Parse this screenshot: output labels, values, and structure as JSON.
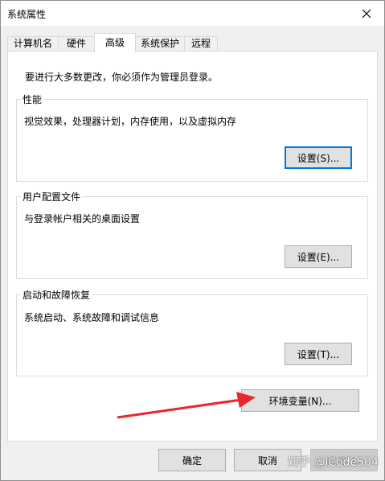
{
  "window": {
    "title": "系统属性"
  },
  "tabs": [
    {
      "label": "计算机名"
    },
    {
      "label": "硬件"
    },
    {
      "label": "高级"
    },
    {
      "label": "系统保护"
    },
    {
      "label": "远程"
    }
  ],
  "panel": {
    "intro": "要进行大多数更改，你必须作为管理员登录。",
    "performance": {
      "title": "性能",
      "desc": "视觉效果，处理器计划，内存使用，以及虚拟内存",
      "button": "设置(S)..."
    },
    "profiles": {
      "title": "用户配置文件",
      "desc": "与登录帐户相关的桌面设置",
      "button": "设置(E)..."
    },
    "startup": {
      "title": "启动和故障恢复",
      "desc": "系统启动、系统故障和调试信息",
      "button": "设置(T)..."
    },
    "env_button": "环境变量(N)..."
  },
  "footer": {
    "ok": "确定",
    "cancel": "取消",
    "apply": "应用(A)"
  },
  "watermark": "知乎 @iCode504",
  "colors": {
    "accent": "#0078d7",
    "arrow": "#e8262c"
  }
}
